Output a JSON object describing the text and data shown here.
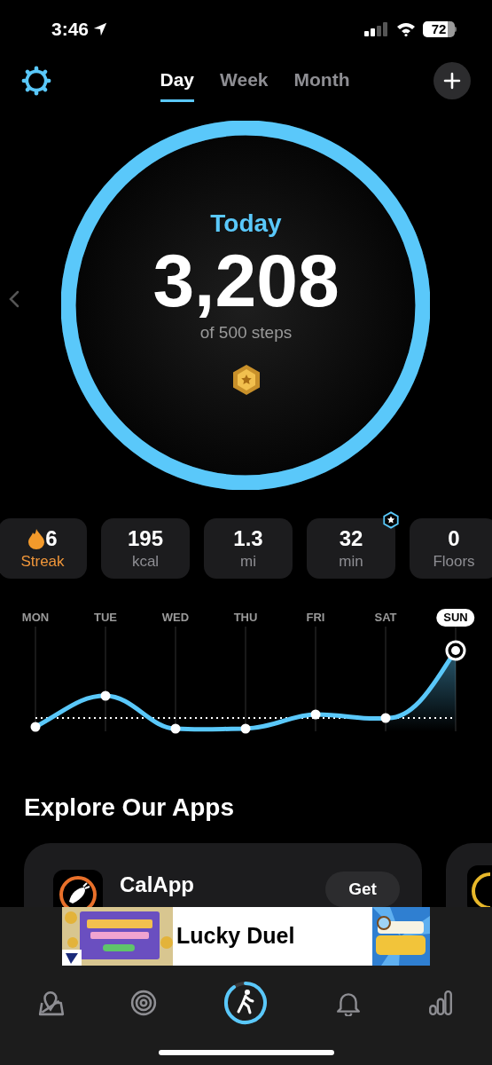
{
  "status_bar": {
    "time": "3:46",
    "battery": "72"
  },
  "tabs": [
    {
      "label": "Day",
      "selected": true
    },
    {
      "label": "Week",
      "selected": false
    },
    {
      "label": "Month",
      "selected": false
    }
  ],
  "progress": {
    "title": "Today",
    "value": "3,208",
    "caption": "of 500 steps",
    "level": 1
  },
  "stats": [
    {
      "kind": "streak",
      "value": "6",
      "label": "Streak"
    },
    {
      "kind": "plain",
      "value": "195",
      "label": "kcal"
    },
    {
      "kind": "plain",
      "value": "1.3",
      "label": "mi"
    },
    {
      "kind": "badge",
      "value": "32",
      "label": "min"
    },
    {
      "kind": "plain",
      "value": "0",
      "label": "Floors"
    }
  ],
  "week": [
    {
      "label": "MON",
      "selected": false
    },
    {
      "label": "TUE",
      "selected": false
    },
    {
      "label": "WED",
      "selected": false
    },
    {
      "label": "THU",
      "selected": false
    },
    {
      "label": "FRI",
      "selected": false
    },
    {
      "label": "SAT",
      "selected": false
    },
    {
      "label": "SUN",
      "selected": true
    }
  ],
  "explore": {
    "heading": "Explore Our Apps",
    "apps": [
      {
        "name": "CalApp",
        "button": "Get"
      }
    ]
  },
  "ad": {
    "title": "Lucky Duel"
  },
  "bottom_nav": [
    {
      "kind": "map",
      "selected": false
    },
    {
      "kind": "target",
      "selected": false
    },
    {
      "kind": "walk",
      "selected": true
    },
    {
      "kind": "bell",
      "selected": false
    },
    {
      "kind": "chart",
      "selected": false
    }
  ]
}
